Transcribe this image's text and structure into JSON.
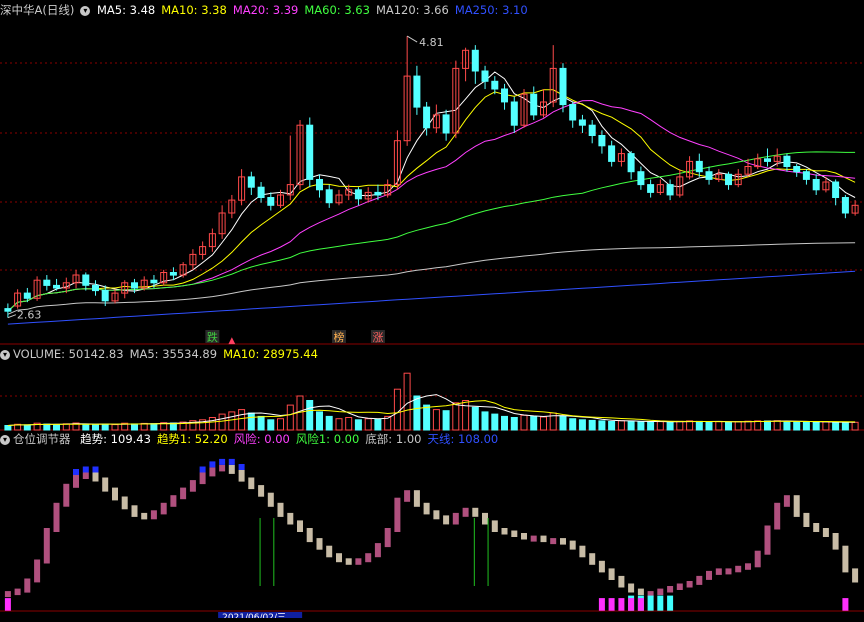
{
  "colors": {
    "up": "#ff4a4a",
    "down": "#54ffff",
    "ma5": "#ffffff",
    "ma10": "#ffff00",
    "ma20": "#ff40ff",
    "ma60": "#40ff40",
    "ma120": "#c8c8c8",
    "ma250": "#3050ff",
    "grid": "#8a0000",
    "title": "#c8c8c8",
    "trend_up": "#b0507e",
    "trend_down": "#c8bca6",
    "risk": "#ff30ff",
    "bottom": "#40ffff",
    "top_blue": "#2030ff",
    "signal": "#20c020"
  },
  "price_panel": {
    "title": "深中华A(日线)",
    "ma_labels": [
      {
        "key": "ma5",
        "text": "MA5: 3.48"
      },
      {
        "key": "ma10",
        "text": "MA10: 3.38"
      },
      {
        "key": "ma20",
        "text": "MA20: 3.39"
      },
      {
        "key": "ma60",
        "text": "MA60: 3.63"
      },
      {
        "key": "ma120",
        "text": "MA120: 3.66"
      },
      {
        "key": "ma250",
        "text": "MA250: 3.10"
      }
    ],
    "high_label": "4.81",
    "low_label": "2.63",
    "badges": [
      {
        "text": "跌",
        "color": "#40d040",
        "idx": 21
      },
      {
        "text": "榜",
        "color": "#ffb050",
        "idx": 34
      },
      {
        "text": "涨",
        "color": "#ff6060",
        "idx": 38
      }
    ]
  },
  "volume_panel": {
    "title": "VOLUME:",
    "values": [
      {
        "key": "vol",
        "text": "VOLUME: 50142.83"
      },
      {
        "key": "ma5",
        "text": "MA5: 35534.89"
      },
      {
        "key": "ma10",
        "text": "MA10: 28975.44"
      }
    ]
  },
  "indicator_panel": {
    "title": "仓位调节器",
    "values": [
      {
        "key": "trend",
        "text": "趋势: 109.43",
        "color": "#ffffff"
      },
      {
        "key": "trend1",
        "text": "趋势1: 52.20",
        "color": "#ffff00"
      },
      {
        "key": "risk",
        "text": "风险: 0.00",
        "color": "#ff40ff"
      },
      {
        "key": "risk1",
        "text": "风险1: 0.00",
        "color": "#40ff40"
      },
      {
        "key": "bottom",
        "text": "底部: 1.00",
        "color": "#c8c8c8"
      },
      {
        "key": "top",
        "text": "天线: 108.00",
        "color": "#3050ff"
      }
    ]
  },
  "axis_labels": {
    "date_label": "2021/06/02/三"
  },
  "chart_data": {
    "type": "candlestick",
    "y_range": [
      2.55,
      4.95
    ],
    "candles": [
      [
        2.7,
        2.68,
        2.74,
        2.63
      ],
      [
        2.72,
        2.82,
        2.85,
        2.7
      ],
      [
        2.82,
        2.78,
        2.86,
        2.75
      ],
      [
        2.78,
        2.92,
        2.95,
        2.76
      ],
      [
        2.92,
        2.88,
        2.96,
        2.84
      ],
      [
        2.88,
        2.86,
        2.93,
        2.84
      ],
      [
        2.86,
        2.9,
        2.94,
        2.82
      ],
      [
        2.9,
        2.96,
        3.0,
        2.86
      ],
      [
        2.96,
        2.88,
        2.98,
        2.84
      ],
      [
        2.88,
        2.84,
        2.92,
        2.8
      ],
      [
        2.84,
        2.76,
        2.88,
        2.72
      ],
      [
        2.76,
        2.82,
        2.85,
        2.74
      ],
      [
        2.82,
        2.9,
        2.92,
        2.78
      ],
      [
        2.9,
        2.86,
        2.93,
        2.82
      ],
      [
        2.86,
        2.92,
        2.95,
        2.84
      ],
      [
        2.92,
        2.9,
        2.96,
        2.86
      ],
      [
        2.9,
        2.98,
        3.0,
        2.88
      ],
      [
        2.98,
        2.96,
        3.02,
        2.92
      ],
      [
        2.96,
        3.04,
        3.06,
        2.94
      ],
      [
        3.04,
        3.12,
        3.16,
        3.0
      ],
      [
        3.12,
        3.18,
        3.22,
        3.08
      ],
      [
        3.18,
        3.28,
        3.32,
        3.14
      ],
      [
        3.28,
        3.44,
        3.5,
        3.24
      ],
      [
        3.44,
        3.54,
        3.58,
        3.4
      ],
      [
        3.54,
        3.72,
        3.78,
        3.5
      ],
      [
        3.72,
        3.64,
        3.76,
        3.58
      ],
      [
        3.64,
        3.56,
        3.68,
        3.52
      ],
      [
        3.56,
        3.5,
        3.6,
        3.46
      ],
      [
        3.5,
        3.58,
        3.62,
        3.48
      ],
      [
        3.58,
        3.66,
        4.04,
        3.54
      ],
      [
        3.66,
        4.12,
        4.16,
        3.62
      ],
      [
        4.12,
        3.7,
        4.18,
        3.64
      ],
      [
        3.7,
        3.62,
        3.74,
        3.56
      ],
      [
        3.62,
        3.52,
        3.66,
        3.48
      ],
      [
        3.52,
        3.58,
        3.62,
        3.5
      ],
      [
        3.58,
        3.62,
        3.66,
        3.54
      ],
      [
        3.62,
        3.55,
        3.64,
        3.5
      ],
      [
        3.55,
        3.6,
        3.64,
        3.52
      ],
      [
        3.6,
        3.58,
        3.66,
        3.54
      ],
      [
        3.58,
        3.66,
        3.7,
        3.56
      ],
      [
        3.66,
        4.0,
        4.08,
        3.62
      ],
      [
        4.0,
        4.5,
        4.81,
        3.96
      ],
      [
        4.5,
        4.26,
        4.58,
        4.2
      ],
      [
        4.26,
        4.1,
        4.3,
        4.04
      ],
      [
        4.1,
        4.2,
        4.28,
        4.06
      ],
      [
        4.2,
        4.06,
        4.24,
        4.0
      ],
      [
        4.06,
        4.56,
        4.62,
        4.02
      ],
      [
        4.56,
        4.7,
        4.72,
        4.46
      ],
      [
        4.7,
        4.54,
        4.74,
        4.44
      ],
      [
        4.54,
        4.46,
        4.58,
        4.4
      ],
      [
        4.46,
        4.4,
        4.5,
        4.36
      ],
      [
        4.4,
        4.3,
        4.44,
        4.24
      ],
      [
        4.3,
        4.12,
        4.34,
        4.06
      ],
      [
        4.12,
        4.36,
        4.4,
        4.1
      ],
      [
        4.36,
        4.2,
        4.42,
        4.16
      ],
      [
        4.2,
        4.3,
        4.4,
        4.18
      ],
      [
        4.3,
        4.56,
        4.74,
        4.26
      ],
      [
        4.56,
        4.28,
        4.6,
        4.22
      ],
      [
        4.28,
        4.16,
        4.3,
        4.1
      ],
      [
        4.16,
        4.12,
        4.2,
        4.06
      ],
      [
        4.12,
        4.04,
        4.16,
        3.98
      ],
      [
        4.04,
        3.96,
        4.08,
        3.9
      ],
      [
        3.96,
        3.84,
        4.0,
        3.8
      ],
      [
        3.84,
        3.9,
        3.94,
        3.8
      ],
      [
        3.9,
        3.76,
        3.92,
        3.7
      ],
      [
        3.76,
        3.66,
        3.8,
        3.62
      ],
      [
        3.66,
        3.6,
        3.7,
        3.56
      ],
      [
        3.6,
        3.66,
        3.7,
        3.58
      ],
      [
        3.66,
        3.58,
        3.7,
        3.54
      ],
      [
        3.58,
        3.72,
        3.78,
        3.56
      ],
      [
        3.72,
        3.84,
        3.88,
        3.7
      ],
      [
        3.84,
        3.76,
        3.9,
        3.72
      ],
      [
        3.76,
        3.7,
        3.8,
        3.66
      ],
      [
        3.7,
        3.74,
        3.78,
        3.68
      ],
      [
        3.74,
        3.66,
        3.76,
        3.62
      ],
      [
        3.66,
        3.74,
        3.78,
        3.64
      ],
      [
        3.74,
        3.8,
        3.86,
        3.72
      ],
      [
        3.8,
        3.86,
        3.9,
        3.78
      ],
      [
        3.86,
        3.84,
        3.94,
        3.8
      ],
      [
        3.84,
        3.88,
        3.94,
        3.8
      ],
      [
        3.88,
        3.8,
        3.9,
        3.76
      ],
      [
        3.8,
        3.76,
        3.82,
        3.72
      ],
      [
        3.76,
        3.7,
        3.78,
        3.66
      ],
      [
        3.7,
        3.62,
        3.74,
        3.58
      ],
      [
        3.62,
        3.68,
        3.72,
        3.6
      ],
      [
        3.68,
        3.56,
        3.7,
        3.5
      ],
      [
        3.56,
        3.44,
        3.58,
        3.4
      ],
      [
        3.44,
        3.5,
        3.54,
        3.42
      ]
    ],
    "volume_range": [
      0,
      60000
    ],
    "volumes": [
      4000,
      5000,
      4500,
      6000,
      5200,
      4800,
      5500,
      6200,
      5000,
      4600,
      5200,
      4800,
      6000,
      5400,
      5800,
      5600,
      6400,
      6200,
      7000,
      8200,
      9000,
      11000,
      14000,
      16000,
      18000,
      15000,
      12000,
      9000,
      10000,
      22000,
      30000,
      26000,
      16000,
      12000,
      10000,
      11000,
      9000,
      10000,
      9500,
      12000,
      36000,
      50142,
      30000,
      22000,
      18000,
      17000,
      24000,
      26000,
      20000,
      16000,
      14000,
      12000,
      11000,
      13000,
      12000,
      11500,
      15000,
      12000,
      10000,
      9000,
      8500,
      8000,
      7500,
      8200,
      7800,
      7200,
      7000,
      7400,
      7000,
      7600,
      8000,
      7600,
      7200,
      7400,
      7000,
      7300,
      7800,
      8000,
      7900,
      8200,
      7600,
      7200,
      7000,
      6800,
      7200,
      6600,
      6400,
      6800
    ],
    "indicator_range": [
      -5,
      125
    ],
    "trend": [
      10,
      12,
      20,
      35,
      60,
      80,
      95,
      102,
      104,
      100,
      92,
      85,
      78,
      72,
      70,
      74,
      80,
      86,
      92,
      98,
      104,
      108,
      110,
      106,
      100,
      94,
      88,
      80,
      72,
      66,
      60,
      52,
      46,
      40,
      36,
      34,
      36,
      40,
      48,
      60,
      84,
      90,
      80,
      74,
      70,
      66,
      72,
      76,
      72,
      66,
      60,
      58,
      56,
      54,
      54,
      52,
      52,
      50,
      46,
      40,
      34,
      28,
      22,
      16,
      12,
      10,
      10,
      12,
      14,
      16,
      18,
      22,
      26,
      28,
      28,
      30,
      32,
      42,
      62,
      80,
      86,
      72,
      64,
      60,
      56,
      46,
      28,
      20
    ],
    "risk": [
      6,
      0,
      0,
      0,
      0,
      0,
      0,
      0,
      0,
      0,
      0,
      0,
      0,
      0,
      0,
      0,
      0,
      0,
      0,
      0,
      0,
      0,
      0,
      0,
      0,
      0,
      0,
      0,
      0,
      0,
      0,
      0,
      0,
      0,
      0,
      0,
      0,
      0,
      0,
      0,
      0,
      0,
      0,
      0,
      0,
      0,
      0,
      0,
      0,
      0,
      0,
      0,
      0,
      0,
      0,
      0,
      0,
      0,
      0,
      0,
      0,
      8,
      10,
      10,
      10,
      10,
      0,
      0,
      0,
      0,
      0,
      0,
      0,
      0,
      0,
      0,
      0,
      0,
      0,
      0,
      0,
      0,
      0,
      0,
      0,
      0,
      6,
      0
    ],
    "signals": [
      26,
      27,
      48,
      49
    ]
  }
}
